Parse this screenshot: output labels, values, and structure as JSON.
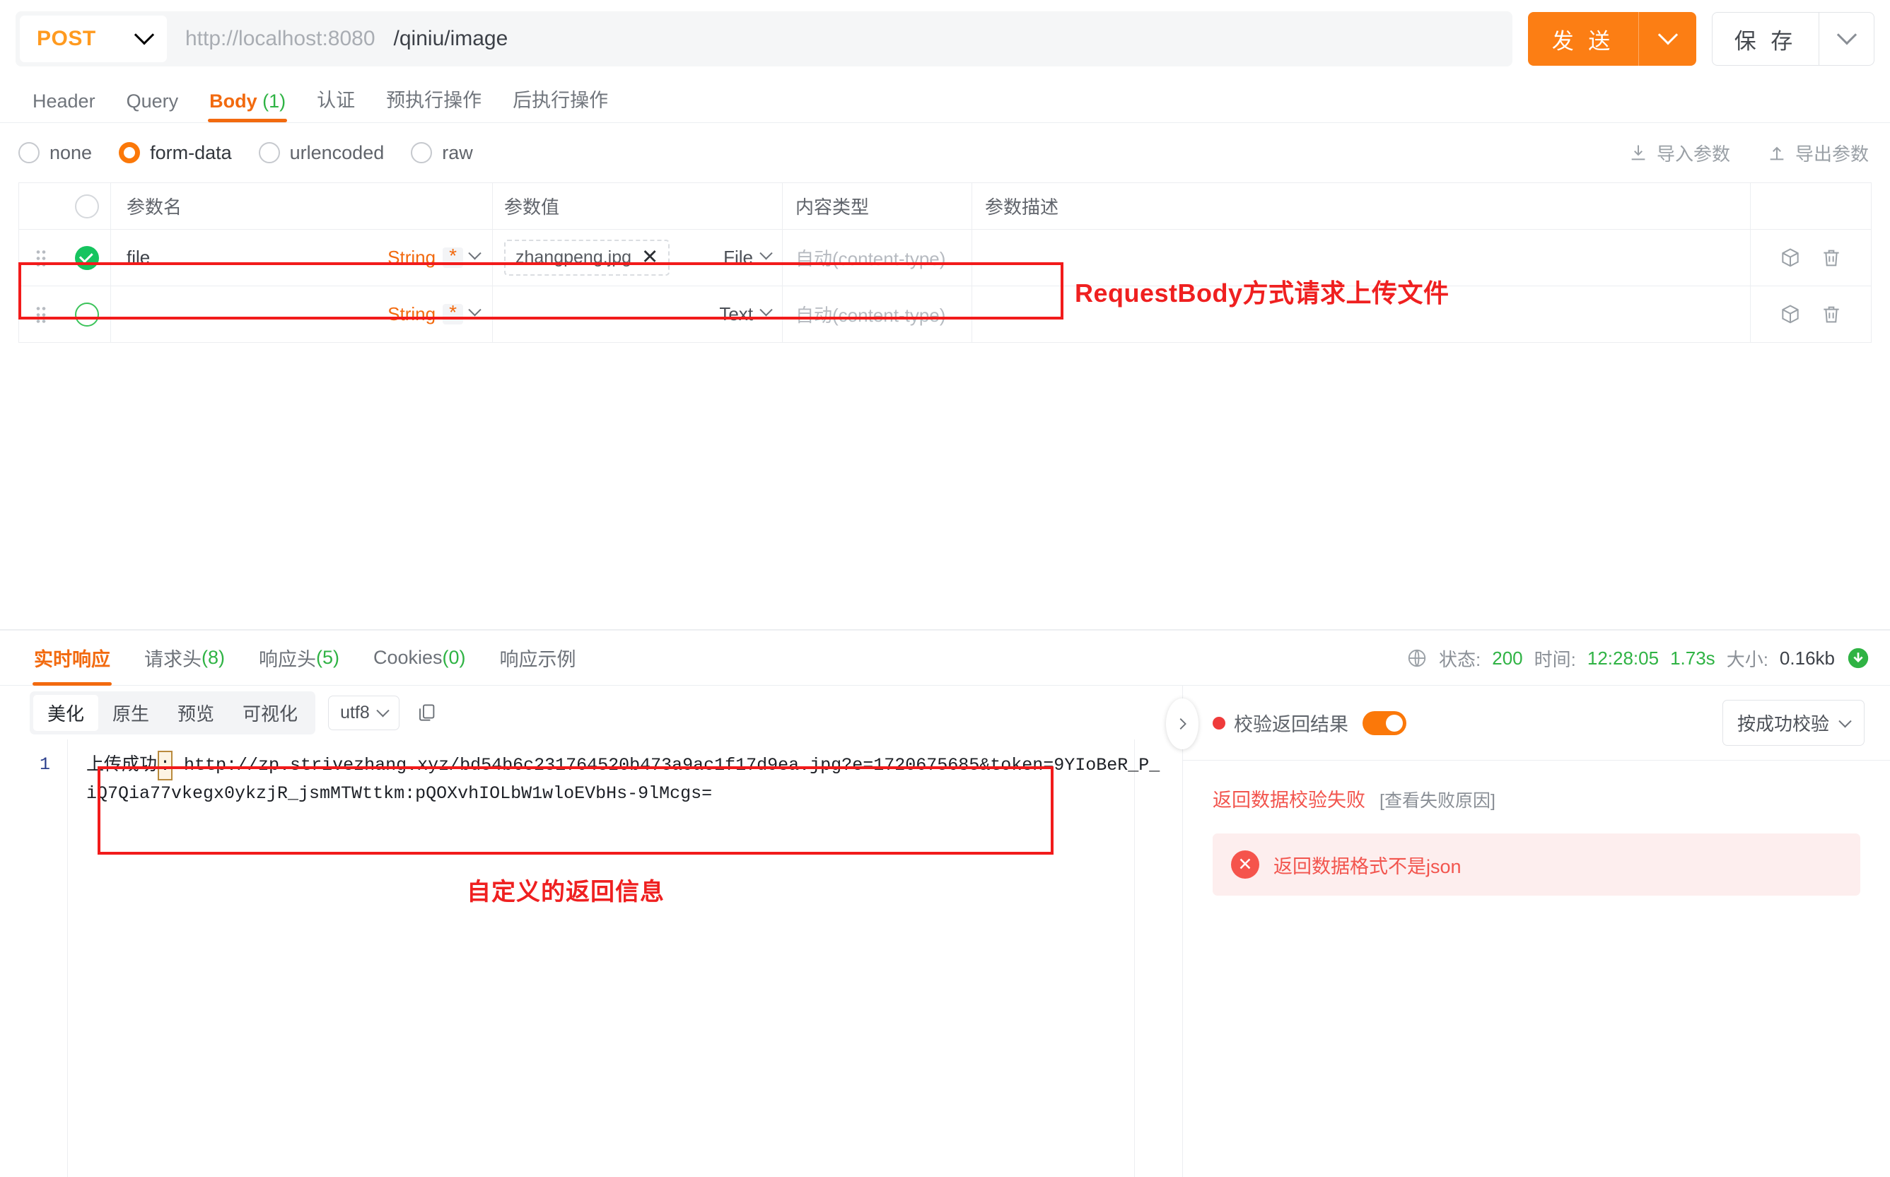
{
  "request": {
    "method": "POST",
    "url_host": "http://localhost:8080",
    "url_path": "/qiniu/image",
    "send_label": "发 送",
    "save_label": "保 存"
  },
  "main_tabs": [
    {
      "label": "Header",
      "count": "",
      "active": false
    },
    {
      "label": "Query",
      "count": "",
      "active": false
    },
    {
      "label": "Body",
      "count": "(1)",
      "active": true
    },
    {
      "label": "认证",
      "count": "",
      "active": false
    },
    {
      "label": "预执行操作",
      "count": "",
      "active": false
    },
    {
      "label": "后执行操作",
      "count": "",
      "active": false
    }
  ],
  "body_types": [
    {
      "label": "none",
      "selected": false
    },
    {
      "label": "form-data",
      "selected": true
    },
    {
      "label": "urlencoded",
      "selected": false
    },
    {
      "label": "raw",
      "selected": false
    }
  ],
  "param_actions": {
    "import_label": "导入参数",
    "export_label": "导出参数",
    "import_icon": "download-icon",
    "export_icon": "upload-icon"
  },
  "param_table": {
    "headers": [
      "参数名",
      "参数值",
      "内容类型",
      "参数描述"
    ],
    "rows": [
      {
        "checked": true,
        "name": "file",
        "type": "String",
        "required_mark": "*",
        "value_file": "zhangpeng.jpg",
        "value_kind": "File",
        "content_type_placeholder": "自动(content-type)",
        "description": ""
      },
      {
        "checked": false,
        "name": "",
        "type": "String",
        "required_mark": "*",
        "value_file": "",
        "value_kind": "Text",
        "content_type_placeholder": "自动(content-type)",
        "description": ""
      }
    ]
  },
  "annotations": {
    "request_note": "RequestBody方式请求上传文件",
    "response_note": "自定义的返回信息"
  },
  "response": {
    "tabs": [
      {
        "label": "实时响应",
        "count": "",
        "active": true
      },
      {
        "label": "请求头",
        "count": "(8)",
        "active": false
      },
      {
        "label": "响应头",
        "count": "(5)",
        "active": false
      },
      {
        "label": "Cookies",
        "count": "(0)",
        "active": false
      },
      {
        "label": "响应示例",
        "count": "",
        "active": false
      }
    ],
    "status": {
      "status_key": "状态:",
      "status_value": "200",
      "time_key": "时间:",
      "time_value": "12:28:05",
      "duration_value": "1.73s",
      "size_key": "大小:",
      "size_value": "0.16kb"
    },
    "toolbar": {
      "view_modes": [
        {
          "label": "美化",
          "active": true
        },
        {
          "label": "原生",
          "active": false
        },
        {
          "label": "预览",
          "active": false
        },
        {
          "label": "可视化",
          "active": false
        }
      ],
      "encoding": "utf8",
      "copy_icon": "copy-icon"
    },
    "editor": {
      "line_number": "1",
      "text_prefix": "上传成功",
      "text_cursor": ":",
      "text_body": " http://zp.strivezhang.xyz/bd54b6c231764520b473a9ac1f17d9ea.jpg?e=1720675685&token=9YIoBeR_P_iQ7Qia77vkegx0ykzjR_jsmMTWttkm:pQOXvhIOLbW1wloEVbHs-9lMcgs="
    }
  },
  "validation": {
    "title": "校验返回结果",
    "toggle_on": true,
    "mode_label": "按成功校验",
    "fail_title": "返回数据校验失败",
    "fail_link": "[查看失败原因]",
    "alert_message": "返回数据格式不是json"
  },
  "colors": {
    "accent_orange": "#fb7809",
    "brand_orange": "#f26a0f",
    "success_green": "#2fb344",
    "error_red": "#f2554e",
    "annotation_red": "#ef2020"
  }
}
